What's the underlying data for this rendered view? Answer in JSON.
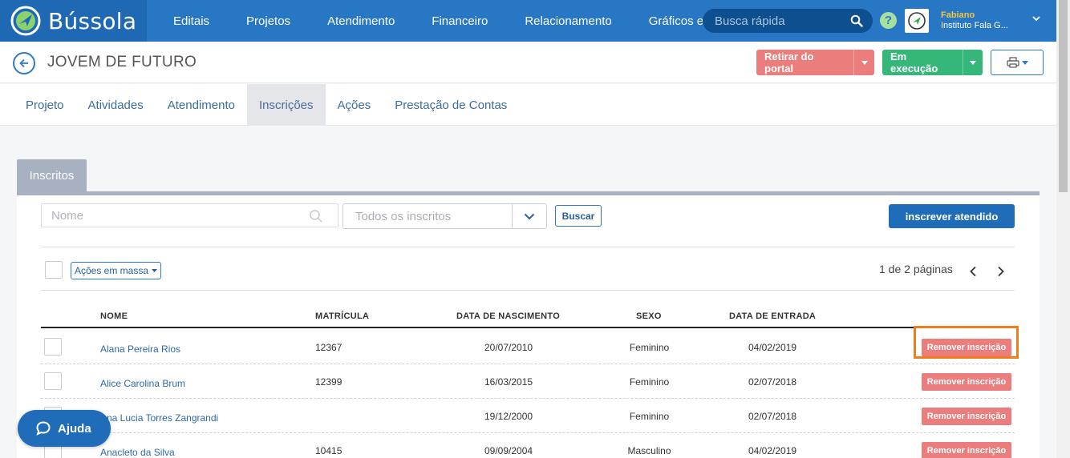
{
  "app": {
    "name": "Bússola"
  },
  "nav": [
    "Editais",
    "Projetos",
    "Atendimento",
    "Financeiro",
    "Relacionamento",
    "Gráficos e Relatórios"
  ],
  "search": {
    "placeholder": "Busca rápida"
  },
  "user": {
    "name": "Fabiano",
    "org": "Instituto Fala G..."
  },
  "page": {
    "title": "JOVEM DE FUTURO"
  },
  "actions": {
    "withdraw": "Retirar do portal",
    "status": "Em execução"
  },
  "tabs": [
    "Projeto",
    "Atividades",
    "Atendimento",
    "Inscrições",
    "Ações",
    "Prestação de Contas"
  ],
  "active_tab": "Inscrições",
  "section": {
    "tab_label": "Inscritos"
  },
  "filters": {
    "name_placeholder": "Nome",
    "select_value": "Todos os inscritos",
    "search_button": "Buscar",
    "enroll_button": "inscrever atendido"
  },
  "bulk": {
    "label": "Ações em massa"
  },
  "pagination": {
    "text": "1 de 2 páginas"
  },
  "table": {
    "headers": {
      "name": "NOME",
      "registration": "MATRÍCULA",
      "birth": "DATA DE NASCIMENTO",
      "sex": "SEXO",
      "entry": "DATA DE ENTRADA"
    },
    "remove_label": "Remover inscrição",
    "rows": [
      {
        "name": "Alana Pereira Rios",
        "registration": "12367",
        "birth": "20/07/2010",
        "sex": "Feminino",
        "entry": "04/02/2019"
      },
      {
        "name": "Alice Carolina Brum",
        "registration": "12399",
        "birth": "16/03/2015",
        "sex": "Feminino",
        "entry": "02/07/2018"
      },
      {
        "name": "Ana Lucia Torres Zangrandi",
        "registration": "",
        "birth": "19/12/2000",
        "sex": "Feminino",
        "entry": "02/07/2018"
      },
      {
        "name": "Anacleto da Silva",
        "registration": "10415",
        "birth": "09/09/2004",
        "sex": "Masculino",
        "entry": "04/02/2019"
      }
    ]
  },
  "help": {
    "label": "Ajuda"
  },
  "colors": {
    "nav": "#2877c5",
    "danger": "#ec7d7d",
    "success": "#35b77a",
    "highlight": "#f07c1e"
  }
}
